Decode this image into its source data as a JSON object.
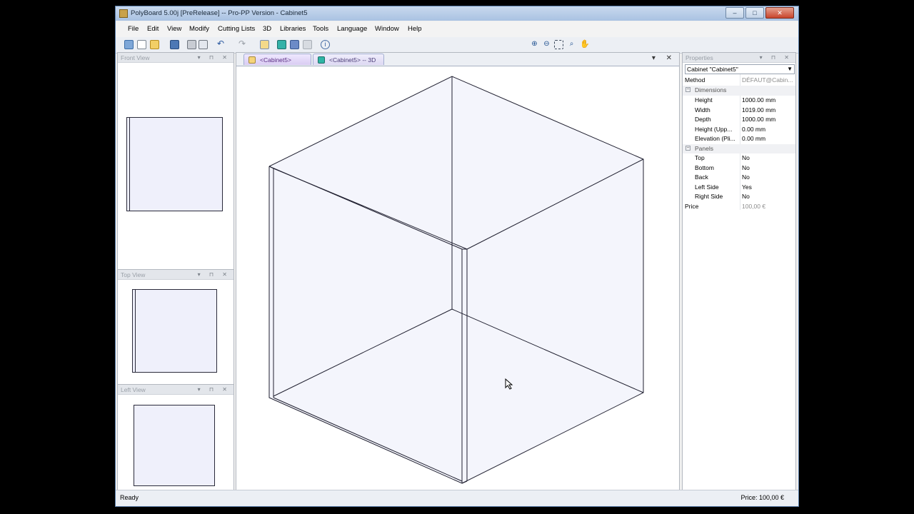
{
  "window": {
    "title": "PolyBoard 5.00j [PreRelease] -- Pro-PP Version - Cabinet5",
    "controls": {
      "minimize": "–",
      "maximize": "□",
      "close": "✕"
    }
  },
  "menu": [
    "File",
    "Edit",
    "View",
    "Modify",
    "Cutting Lists",
    "3D",
    "Libraries",
    "Tools",
    "Language",
    "Window",
    "Help"
  ],
  "panes": {
    "front_view": "Front View",
    "top_view": "Top View",
    "left_view": "Left View"
  },
  "tabs": [
    {
      "label": "<Cabinet5>",
      "active": true
    },
    {
      "label": "<Cabinet5> -- 3D",
      "active": false
    }
  ],
  "properties": {
    "header": "Properties",
    "selected_object": "Cabinet \"Cabinet5\"",
    "method_label": "Method",
    "method_value": "DÉFAUT@Cabin...",
    "dimensions_label": "Dimensions",
    "dimensions": [
      {
        "name": "Height",
        "value": "1000.00 mm"
      },
      {
        "name": "Width",
        "value": "1019.00 mm"
      },
      {
        "name": "Depth",
        "value": "1000.00 mm"
      },
      {
        "name": "Height (Upp...",
        "value": "0.00 mm"
      },
      {
        "name": "Elevation (Pli...",
        "value": "0.00 mm"
      }
    ],
    "panels_label": "Panels",
    "panels": [
      {
        "name": "Top",
        "value": "No"
      },
      {
        "name": "Bottom",
        "value": "No"
      },
      {
        "name": "Back",
        "value": "No"
      },
      {
        "name": "Left Side",
        "value": "Yes"
      },
      {
        "name": "Right Side",
        "value": "No"
      }
    ],
    "price_label": "Price",
    "price_value": "100,00 €"
  },
  "status": {
    "left": "Ready",
    "right": "Price: 100,00 €"
  },
  "colors": {
    "panel_fill": "#eff0fb",
    "title_bar": "#b9cde6",
    "tab_active": "#e2d6f6"
  },
  "icons": [
    "app-icon",
    "cursor-icon",
    "zoom-in-icon",
    "zoom-out-icon",
    "zoom-window-icon",
    "zoom-extents-icon",
    "pan-hand-icon"
  ]
}
